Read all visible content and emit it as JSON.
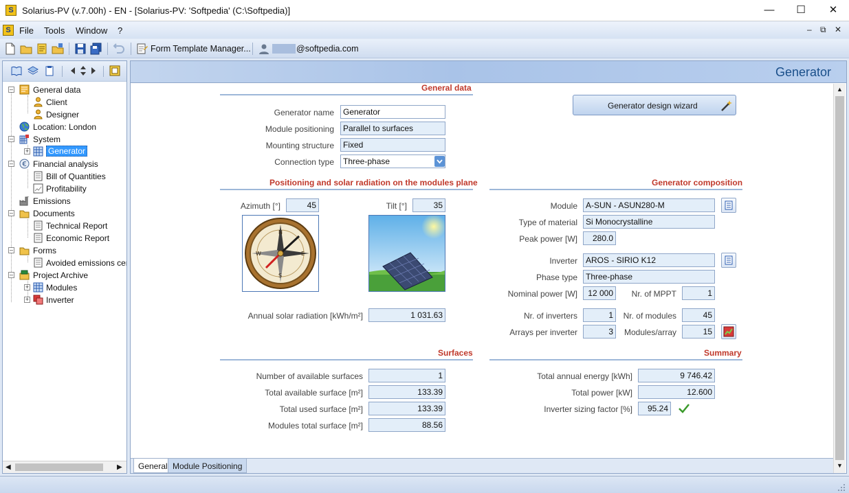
{
  "window": {
    "title": "Solarius-PV (v.7.00h) - EN - [Solarius-PV: 'Softpedia' (C:\\Softpedia)]",
    "minimize": "—",
    "maximize": "☐",
    "close": "✕"
  },
  "menu": {
    "items": [
      "File",
      "Tools",
      "Window",
      "?"
    ],
    "mdi_min": "–",
    "mdi_restore": "⧉",
    "mdi_close": "✕"
  },
  "toolbar": {
    "form_template_manager": "Form Template Manager...",
    "user_email": "@softpedia.com"
  },
  "tree": {
    "items": [
      "General data",
      "Client",
      "Designer",
      "Location: London",
      "System",
      "Generator",
      "Financial analysis",
      "Bill of Quantities",
      "Profitability",
      "Emissions",
      "Documents",
      "Technical Report",
      "Economic Report",
      "Forms",
      "Avoided emissions certif",
      "Project Archive",
      "Modules",
      "Inverter"
    ]
  },
  "main": {
    "header_title": "Generator",
    "general": {
      "section_title": "General data",
      "generator_name_label": "Generator name",
      "generator_name": "Generator",
      "module_positioning_label": "Module positioning",
      "module_positioning": "Parallel to surfaces",
      "mounting_structure_label": "Mounting structure",
      "mounting_structure": "Fixed",
      "connection_type_label": "Connection type",
      "connection_type": "Three-phase"
    },
    "wizard_button": "Generator design wizard",
    "positioning": {
      "section_title": "Positioning and solar radiation on the modules plane",
      "azimuth_label": "Azimuth [°]",
      "azimuth": "45",
      "tilt_label": "Tilt [°]",
      "tilt": "35",
      "annual_radiation_label": "Annual solar radiation [kWh/m²]",
      "annual_radiation": "1 031.63"
    },
    "composition": {
      "section_title": "Generator composition",
      "module_label": "Module",
      "module": "A-SUN - ASUN280-M",
      "material_label": "Type of material",
      "material": "Si  Monocrystalline",
      "peak_power_label": "Peak power [W]",
      "peak_power": "280.0",
      "inverter_label": "Inverter",
      "inverter": "AROS - SIRIO K12",
      "phase_type_label": "Phase type",
      "phase_type": "Three-phase",
      "nominal_power_label": "Nominal power [W]",
      "nominal_power": "12 000",
      "mppt_label": "Nr. of MPPT",
      "mppt": "1",
      "nr_inverters_label": "Nr. of inverters",
      "nr_inverters": "1",
      "nr_modules_label": "Nr. of modules",
      "nr_modules": "45",
      "arrays_label": "Arrays per inverter",
      "arrays": "3",
      "modules_array_label": "Modules/array",
      "modules_array": "15"
    },
    "surfaces": {
      "section_title": "Surfaces",
      "available_count_label": "Number of available surfaces",
      "available_count": "1",
      "total_available_label": "Total available surface [m²]",
      "total_available": "133.39",
      "total_used_label": "Total used surface [m²]",
      "total_used": "133.39",
      "modules_total_label": "Modules total surface [m²]",
      "modules_total": "88.56"
    },
    "summary": {
      "section_title": "Summary",
      "annual_energy_label": "Total annual energy [kWh]",
      "annual_energy": "9 746.42",
      "total_power_label": "Total power [kW]",
      "total_power": "12.600",
      "sizing_factor_label": "Inverter sizing factor [%]",
      "sizing_factor": "95.24"
    },
    "tabs": [
      "General",
      "Module Positioning"
    ]
  },
  "colors": {
    "section_title": "#c0392b",
    "field_bg": "#e3eef9",
    "selection": "#3399ff",
    "header_text": "#1a4f8a"
  }
}
